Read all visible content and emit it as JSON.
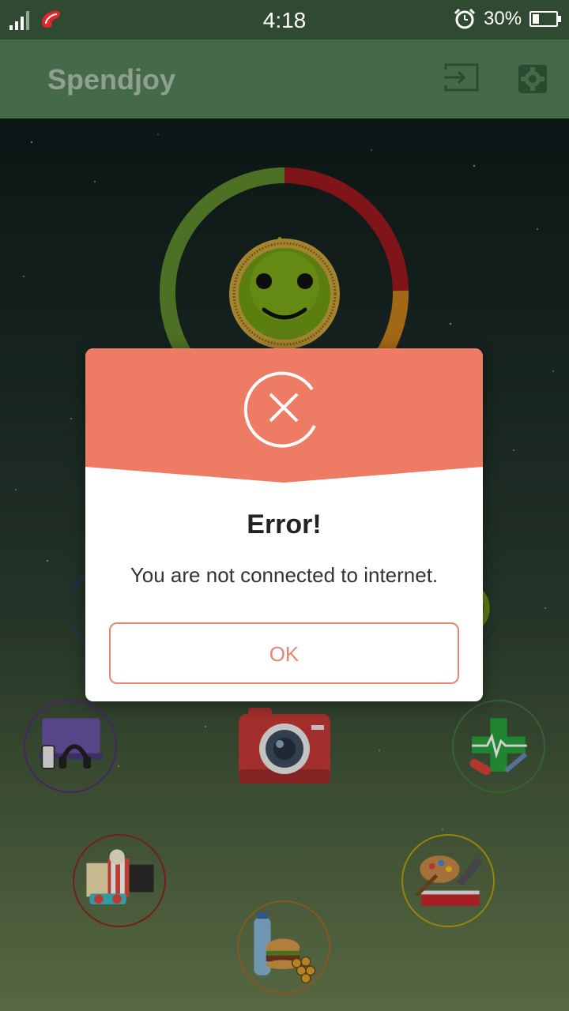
{
  "status_bar": {
    "time": "4:18",
    "battery_percent": "30%",
    "battery_level": 0.3
  },
  "app_bar": {
    "title": "Spendjoy",
    "icons": [
      "login-icon",
      "gear-icon"
    ]
  },
  "dialog": {
    "title": "Error!",
    "message": "You are not connected to internet.",
    "ok_label": "OK",
    "icon": "error-x-icon",
    "accent_color": "#ee7b64"
  },
  "categories": [
    {
      "name": "electronics-icon",
      "ring_color": "#5a2c7a"
    },
    {
      "name": "health-icon",
      "ring_color": "#3f7a3a"
    },
    {
      "name": "entertainment-icon",
      "ring_color": "#8e2424"
    },
    {
      "name": "hobbies-icon",
      "ring_color": "#b8a20e"
    },
    {
      "name": "food-icon",
      "ring_color": "#a86a28"
    },
    {
      "name": "camera-icon",
      "ring_color": "#c6403c"
    }
  ],
  "colors": {
    "status_bar": "#2f4a30",
    "app_bar": "#456a48",
    "gauge_green": "#5e8a2c",
    "gauge_red": "#9b1a1e",
    "gauge_orange": "#c77f1a"
  }
}
